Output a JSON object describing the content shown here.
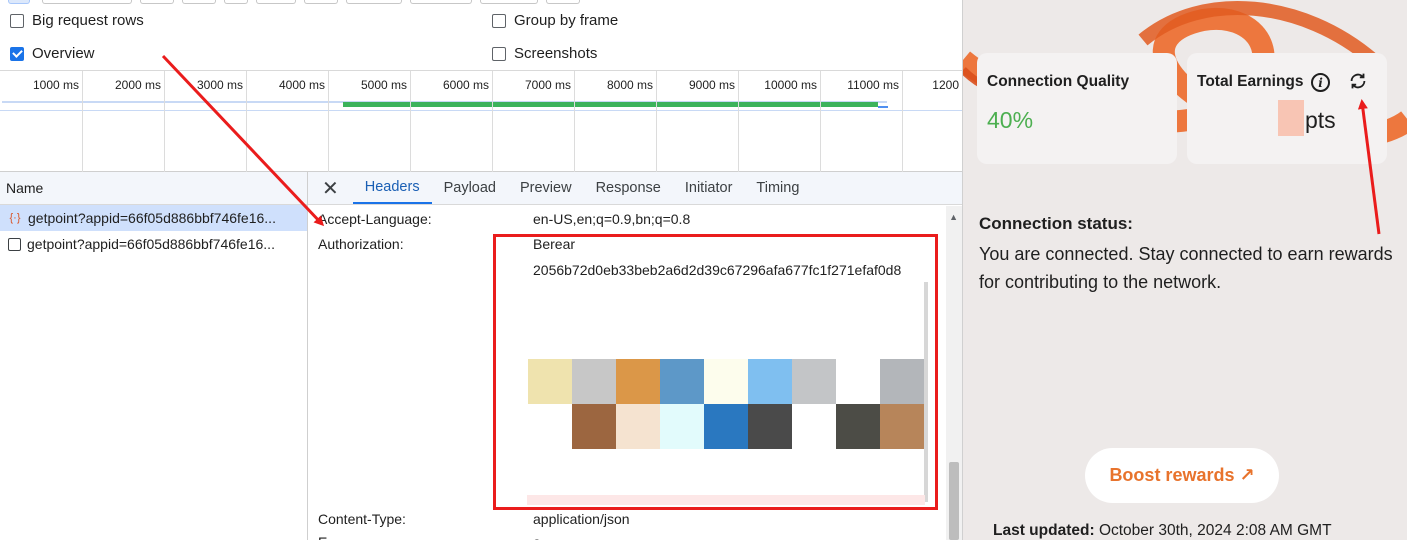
{
  "devtools": {
    "options": {
      "big_request_rows": "Big request rows",
      "group_by_frame": "Group by frame",
      "overview": "Overview",
      "screenshots": "Screenshots"
    },
    "timeline_ticks": [
      "1000 ms",
      "2000 ms",
      "3000 ms",
      "4000 ms",
      "5000 ms",
      "6000 ms",
      "7000 ms",
      "8000 ms",
      "9000 ms",
      "10000 ms",
      "11000 ms",
      "1200"
    ],
    "name_header": "Name",
    "requests": [
      {
        "name": "getpoint?appid=66f05d886bbf746fe16...",
        "type": "xhr"
      },
      {
        "name": "getpoint?appid=66f05d886bbf746fe16...",
        "type": "doc"
      }
    ],
    "tabs": [
      "Headers",
      "Payload",
      "Preview",
      "Response",
      "Initiator",
      "Timing"
    ],
    "active_tab": "Headers",
    "headers": {
      "accept_language_name": "Accept-Language:",
      "accept_language_value": "en-US,en;q=0.9,bn;q=0.8",
      "authorization_name": "Authorization:",
      "authorization_value_line1": "Berear",
      "authorization_value_line2": "2056b72d0eb33beb2a6d2d39c67296afa677fc1f271efaf0d8",
      "content_type_name": "Content-Type:",
      "content_type_value": "application/json"
    },
    "mosaic_colors": [
      "#efe3ae",
      "#c7c7c7",
      "#db9748",
      "#5d98c8",
      "#fdfded",
      "#7fbff0",
      "#c3c5c7",
      "#ffffff",
      "#b3b6ba",
      "#ffffff",
      "#9c6640",
      "#f5e3d0",
      "#e2fbfc",
      "#2a78c0",
      "#4a4a4a",
      "#ffffff",
      "#4c4c46",
      "#b7855a"
    ]
  },
  "panel": {
    "connection_quality_label": "Connection Quality",
    "connection_quality_value": "40%",
    "total_earnings_label": "Total Earnings",
    "total_earnings_value": "pts",
    "connection_status_label": "Connection status:",
    "connection_status_text": "You are connected. Stay connected to earn rewards for contributing to the network.",
    "boost_button": "Boost rewards ↗",
    "last_updated_label": "Last updated:",
    "last_updated_value": "October 30th, 2024 2:08 AM GMT",
    "accent_color": "#e8732c",
    "quality_color": "#4caf50"
  }
}
